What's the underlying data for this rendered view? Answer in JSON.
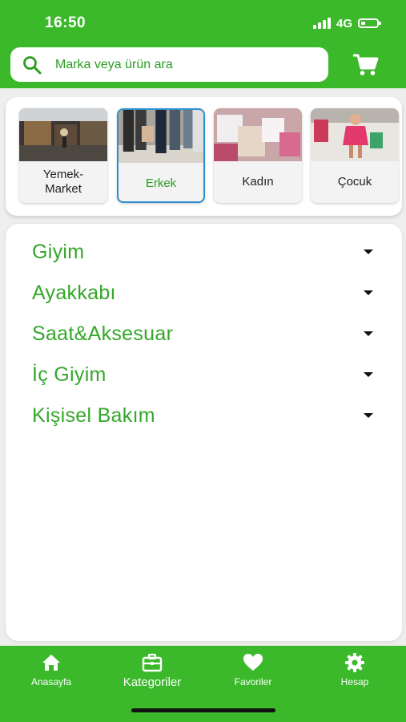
{
  "status_bar": {
    "time": "16:50",
    "network": "4G"
  },
  "search": {
    "placeholder": "Marka veya ürün ara",
    "icon": "search-icon"
  },
  "header": {
    "cart_icon": "cart-icon",
    "brand_color": "#3bb92a"
  },
  "categories": [
    {
      "label": "Yemek-\nMarket",
      "selected": false
    },
    {
      "label": "Erkek",
      "selected": true
    },
    {
      "label": "Kadın",
      "selected": false
    },
    {
      "label": "Çocuk",
      "selected": false
    }
  ],
  "subcategories": [
    {
      "label": "Giyim"
    },
    {
      "label": "Ayakkabı"
    },
    {
      "label": "Saat&Aksesuar"
    },
    {
      "label": "İç Giyim"
    },
    {
      "label": "Kişisel Bakım"
    }
  ],
  "bottom_nav": [
    {
      "label": "Anasayfa",
      "icon": "home-icon",
      "active": false
    },
    {
      "label": "Kategoriler",
      "icon": "briefcase-icon",
      "active": true
    },
    {
      "label": "Favoriler",
      "icon": "heart-icon",
      "active": false
    },
    {
      "label": "Hesap",
      "icon": "gear-icon",
      "active": false
    }
  ]
}
